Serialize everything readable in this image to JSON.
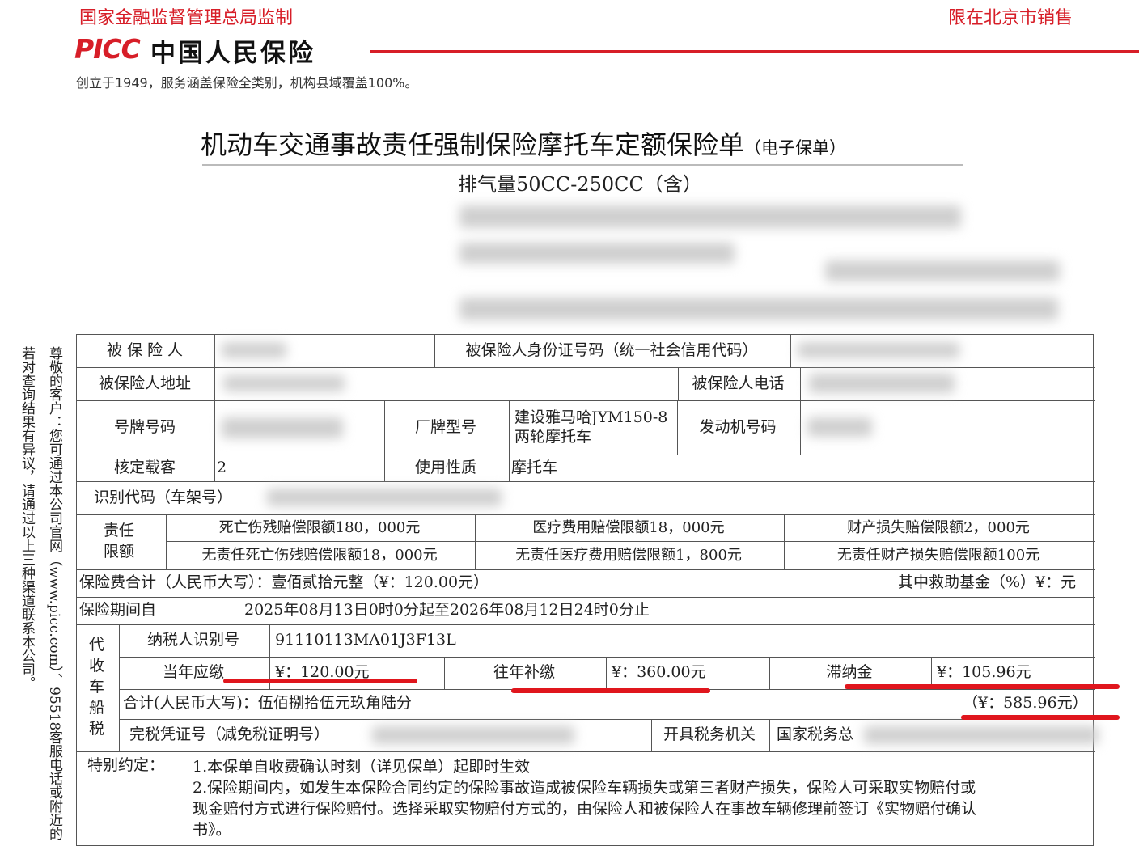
{
  "header": {
    "regulator": "国家金融监督管理总局监制",
    "region": "限在北京市销售"
  },
  "brand": {
    "mark": "PICC",
    "name": "中国人民保险",
    "slogan": "创立于1949，服务涵盖保险全类别，机构县域覆盖100%。",
    "color": "#d71e28"
  },
  "title": {
    "main": "机动车交通事故责任强制保险摩托车定额保险单",
    "suffix": "（电子保单）",
    "sub": "排气量50CC-250CC（含）"
  },
  "side_notice": {
    "line1": "若对查询结果有异议，请通过以上三种渠道联系本公司。",
    "line2": "尊敬的客户：您可通过本公司官网（www.picc.com）、95518客服电话或附近的"
  },
  "form": {
    "insured_label": "被 保 险 人",
    "insured_value": "",
    "id_label": "被保险人身份证号码（统一社会信用代码）",
    "address_label": "被保险人地址",
    "phone_label": "被保险人电话",
    "plate_label": "号牌号码",
    "brand_model_label": "厂牌型号",
    "brand_model_value_1": "建设雅马哈JYM150-8",
    "brand_model_value_2": "两轮摩托车",
    "engine_label": "发动机号码",
    "seats_label": "核定载客",
    "seats_value": "2",
    "usage_label": "使用性质",
    "usage_value": "摩托车",
    "vin_label": "识别代码（车架号）",
    "liability_label_1": "责任",
    "liability_label_2": "限额",
    "limits": [
      "死亡伤残赔偿限额180，000元",
      "医疗费用赔偿限额18，000元",
      "财产损失赔偿限额2，000元",
      "无责任死亡伤残赔偿限额18，000元",
      "无责任医疗费用赔偿限额1，800元",
      "无责任财产损失赔偿限额100元"
    ],
    "premium_total": "保险费合计（人民币大写）：壹佰贰拾元整（¥：120.00元）",
    "rescue_fund": "其中救助基金（%）¥：元",
    "period_label": "保险期间自",
    "period_value": "2025年08月13日0时0分起至2026年08月12日24时0分止",
    "tax_side": [
      "代",
      "收",
      "车",
      "船",
      "税"
    ],
    "taxpayer_id_label": "纳税人识别号",
    "taxpayer_id_value": "91110113MA01J3F13L",
    "current_year_label": "当年应缴",
    "current_year_value": "¥：120.00元",
    "past_years_label": "往年补缴",
    "past_years_value": "¥：360.00元",
    "late_fee_label": "滞纳金",
    "late_fee_value": "¥：105.96元",
    "tax_total_label": "合计(人民币大写)：伍佰捌拾伍元玖角陆分",
    "tax_total_value": "（¥：585.96元）",
    "tax_cert_label": "完税凭证号（减免税证明号）",
    "tax_office_label": "开具税务机关",
    "tax_office_value": "国家税务总",
    "special_label": "特别约定：",
    "special_1": "1.本保单自收费确认时刻（详见保单）起即时生效",
    "special_2a": "2.保险期间内，如发生本保险合同约定的保险事故造成被保险车辆损失或第三者财产损失，保险人可采取实物赔付或",
    "special_2b": "现金赔付方式进行保险赔付。选择采取实物赔付方式的，由保险人和被保险人在事故车辆修理前签订《实物赔付确认",
    "special_2c": "书》。"
  },
  "colors": {
    "annotation_red": "#e0161d",
    "border": "#555555"
  }
}
